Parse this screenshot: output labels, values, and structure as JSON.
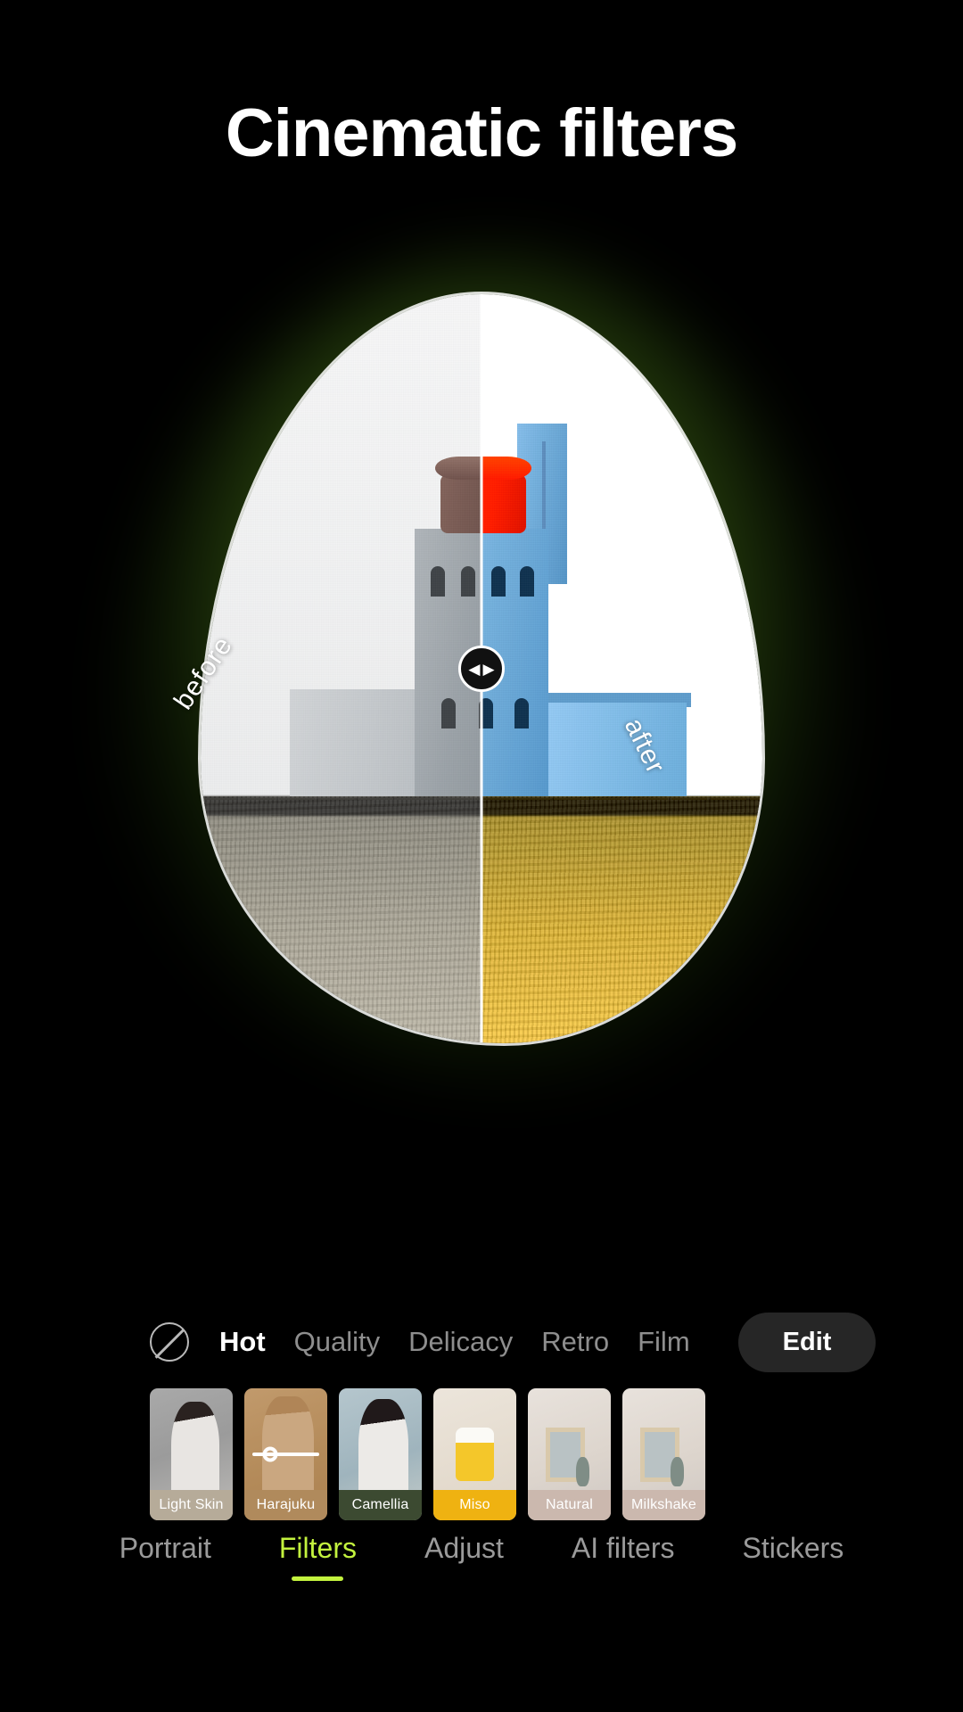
{
  "header": {
    "title": "Cinematic filters"
  },
  "preview": {
    "before_label": "before",
    "after_label": "after",
    "handle_left_icon": "◀",
    "handle_right_icon": "▶",
    "subject": "lighthouse"
  },
  "categories": {
    "no_filter_icon": "no-filter-icon",
    "items": [
      {
        "label": "Hot",
        "active": true
      },
      {
        "label": "Quality",
        "active": false
      },
      {
        "label": "Delicacy",
        "active": false
      },
      {
        "label": "Retro",
        "active": false
      },
      {
        "label": "Film",
        "active": false
      }
    ],
    "edit_label": "Edit"
  },
  "filters": [
    {
      "label": "Light Skin",
      "cap_color": "#b6ab99",
      "selected": false
    },
    {
      "label": "Harajuku",
      "cap_color": "#b08a5c",
      "selected": true
    },
    {
      "label": "Camellia",
      "cap_color": "#3c4a31",
      "selected": false
    },
    {
      "label": "Miso",
      "cap_color": "#efb211",
      "selected": false
    },
    {
      "label": "Natural",
      "cap_color": "#cbb8ae",
      "selected": false
    },
    {
      "label": "Milkshake",
      "cap_color": "#cbb8ae",
      "selected": false
    }
  ],
  "bottom_nav": [
    {
      "label": "Portrait",
      "active": false
    },
    {
      "label": "Filters",
      "active": true
    },
    {
      "label": "Adjust",
      "active": false
    },
    {
      "label": "AI filters",
      "active": false
    },
    {
      "label": "Stickers",
      "active": false
    }
  ],
  "colors": {
    "accent": "#c3f23e",
    "background": "#000000",
    "muted_text": "#9a9a9a",
    "edit_pill": "#262626"
  }
}
